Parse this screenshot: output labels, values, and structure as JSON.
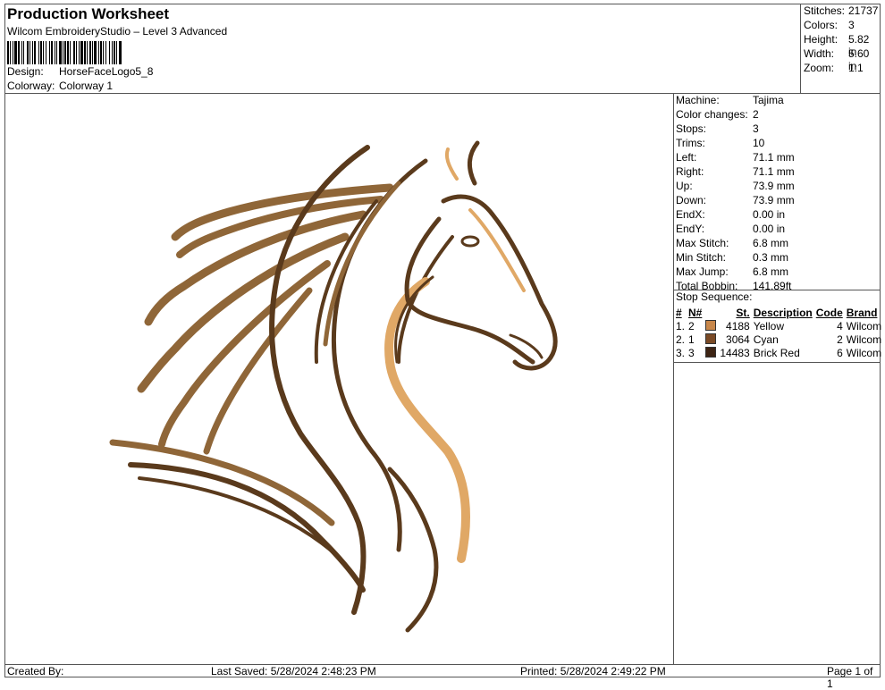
{
  "header": {
    "title": "Production Worksheet",
    "subtitle": "Wilcom EmbroideryStudio – Level 3 Advanced",
    "design_label": "Design:",
    "design_value": "HorseFaceLogo5_8",
    "colorway_label": "Colorway:",
    "colorway_value": "Colorway 1"
  },
  "stats": [
    {
      "label": "Stitches:",
      "value": "21737"
    },
    {
      "label": "Colors:",
      "value": "3"
    },
    {
      "label": "Height:",
      "value": "5.82 in"
    },
    {
      "label": "Width:",
      "value": "5.60 in"
    },
    {
      "label": "Zoom:",
      "value": "1:1"
    }
  ],
  "machine_info": [
    {
      "label": "Machine:",
      "value": "Tajima"
    },
    {
      "label": "Color changes:",
      "value": "2"
    },
    {
      "label": "Stops:",
      "value": "3"
    },
    {
      "label": "Trims:",
      "value": "10"
    },
    {
      "label": "Left:",
      "value": "71.1 mm"
    },
    {
      "label": "Right:",
      "value": "71.1 mm"
    },
    {
      "label": "Up:",
      "value": "73.9 mm"
    },
    {
      "label": "Down:",
      "value": "73.9 mm"
    },
    {
      "label": "EndX:",
      "value": "0.00 in"
    },
    {
      "label": "EndY:",
      "value": "0.00 in"
    },
    {
      "label": "Max Stitch:",
      "value": "6.8 mm"
    },
    {
      "label": "Min Stitch:",
      "value": "0.3 mm"
    },
    {
      "label": "Max Jump:",
      "value": "6.8 mm"
    },
    {
      "label": "Total Bobbin:",
      "value": "141.89ft"
    }
  ],
  "stop_sequence": {
    "title": "Stop Sequence:",
    "headers": {
      "idx": "#",
      "n": "N#",
      "st": "St.",
      "desc": "Description",
      "code": "Code",
      "brand": "Brand"
    },
    "rows": [
      {
        "idx": "1.",
        "n": "2",
        "color": "#c8874a",
        "st": "4188",
        "desc": "Yellow",
        "code": "4",
        "brand": "Wilcom"
      },
      {
        "idx": "2.",
        "n": "1",
        "color": "#7a4a26",
        "st": "3064",
        "desc": "Cyan",
        "code": "2",
        "brand": "Wilcom"
      },
      {
        "idx": "3.",
        "n": "3",
        "color": "#3d2414",
        "st": "14483",
        "desc": "Brick Red",
        "code": "6",
        "brand": "Wilcom"
      }
    ]
  },
  "footer": {
    "created_by": "Created By:",
    "last_saved": "Last Saved: 5/28/2024 2:48:23 PM",
    "printed": "Printed: 5/28/2024 2:49:22 PM",
    "page": "Page 1 of 1"
  },
  "design_image": {
    "icon": "horse-head-embroidery",
    "colors": [
      "#e0a866",
      "#8f6638",
      "#5a3a1c"
    ]
  }
}
